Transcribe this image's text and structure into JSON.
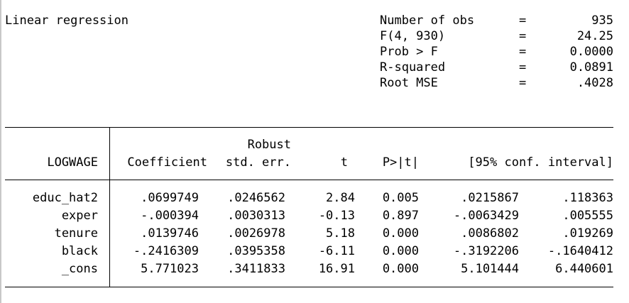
{
  "title": "Linear regression",
  "stats": [
    {
      "label": "Number of obs",
      "eq": "=",
      "value": "935"
    },
    {
      "label": "F(4, 930)",
      "eq": "=",
      "value": "24.25"
    },
    {
      "label": "Prob > F",
      "eq": "=",
      "value": "0.0000"
    },
    {
      "label": "R-squared",
      "eq": "=",
      "value": "0.0891"
    },
    {
      "label": "Root MSE",
      "eq": "=",
      "value": ".4028"
    }
  ],
  "table": {
    "header_top": "Robust",
    "columns": [
      "LOGWAGE",
      "Coefficient",
      "std. err.",
      "t",
      "P>|t|",
      "[95% conf. interval]"
    ],
    "rows": [
      {
        "var": "educ_hat2",
        "coef": ".0699749",
        "se": ".0246562",
        "t": "2.84",
        "p": "0.005",
        "lo": ".0215867",
        "hi": ".118363"
      },
      {
        "var": "exper",
        "coef": "-.000394",
        "se": ".0030313",
        "t": "-0.13",
        "p": "0.897",
        "lo": "-.0063429",
        "hi": ".005555"
      },
      {
        "var": "tenure",
        "coef": ".0139746",
        "se": ".0026978",
        "t": "5.18",
        "p": "0.000",
        "lo": ".0086802",
        "hi": ".019269"
      },
      {
        "var": "black",
        "coef": "-.2416309",
        "se": ".0395358",
        "t": "-6.11",
        "p": "0.000",
        "lo": "-.3192206",
        "hi": "-.1640412"
      },
      {
        "var": "_cons",
        "coef": "5.771023",
        "se": ".3411833",
        "t": "16.91",
        "p": "0.000",
        "lo": "5.101444",
        "hi": "6.440601"
      }
    ]
  }
}
